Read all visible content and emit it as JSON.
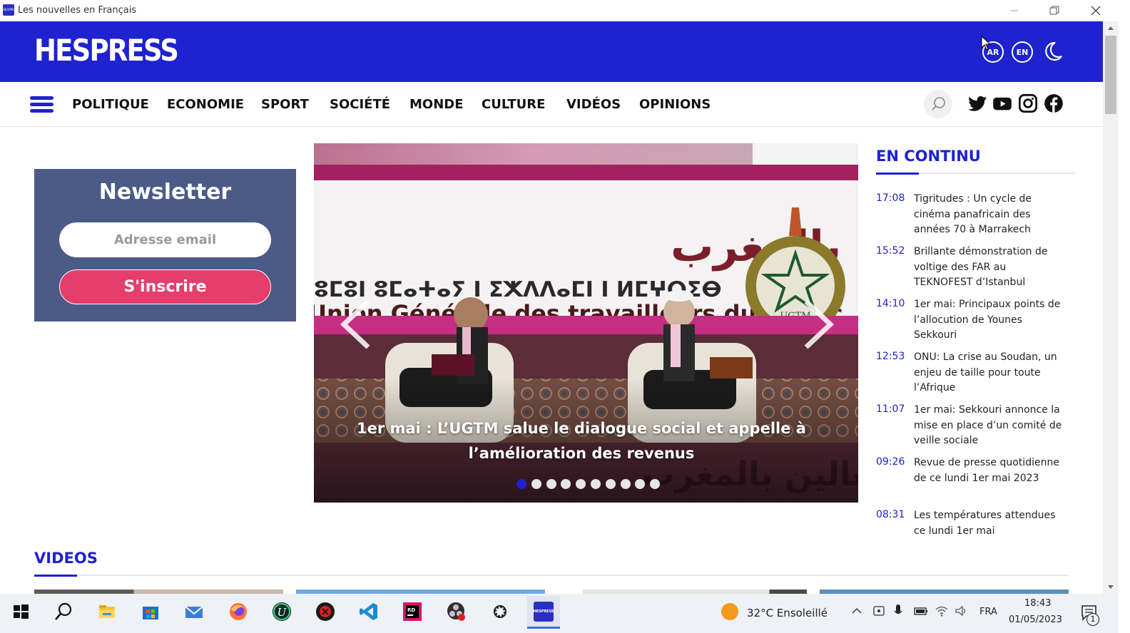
{
  "window": {
    "title": "Les nouvelles en Français",
    "app_icon_text": "HESPRESS"
  },
  "header": {
    "logo": "HESPRESS",
    "lang_ar": "AR",
    "lang_en": "EN",
    "bg_color": "#1e22cf"
  },
  "nav": {
    "items": [
      "POLITIQUE",
      "ECONOMIE",
      "SPORT",
      "SOCIÉTÉ",
      "MONDE",
      "CULTURE",
      "VIDÉOS",
      "OPINIONS"
    ],
    "socials": [
      "twitter-icon",
      "youtube-icon",
      "instagram-icon",
      "facebook-icon"
    ]
  },
  "newsletter": {
    "title": "Newsletter",
    "email_placeholder": "Adresse email",
    "submit_label": "S'inscrire",
    "bg_color": "#4b5a87",
    "button_color": "#e53d6c"
  },
  "hero": {
    "caption": "1er mai : L’UGTM salue le dialogue social et appelle à l’amélioration des revenus",
    "banner_arabic": "الاتحاد العام للشغالين بالمغرب",
    "banner_tifinagh": "ⵓⵎⵓⵏ ⵓⵎⴰⵜⴰⵢ ⵏ ⵉⵅⴷⴷⴰⵎⵏ ⵏ ⵍⵎⵖⵔⵉⴱ",
    "banner_french": "Union Générale des travailleurs du Maroc",
    "emblem_text": "UGTM",
    "slides_total": 10,
    "active_slide": 1
  },
  "en_continu": {
    "title": "EN CONTINU",
    "items": [
      {
        "time": "17:08",
        "text": "Tigritudes : Un cycle de cinéma panafricain des années 70 à Marrakech"
      },
      {
        "time": "15:52",
        "text": "Brillante démonstration de voltige des FAR au TEKNOFEST d’Istanbul"
      },
      {
        "time": "14:10",
        "text": "1er mai: Principaux points de l’allocution de Younes Sekkouri"
      },
      {
        "time": "12:53",
        "text": "ONU: La crise au Soudan, un enjeu de taille pour toute l’Afrique"
      },
      {
        "time": "11:07",
        "text": "1er mai: Sekkouri annonce la mise en place d’un comité de veille sociale"
      },
      {
        "time": "09:26",
        "text": "Revue de presse quotidienne de ce lundi 1er mai 2023"
      },
      {
        "time": "08:31",
        "text": "Les températures attendues ce lundi 1er mai"
      }
    ]
  },
  "videos": {
    "title": "VIDEOS"
  },
  "taskbar": {
    "weather": "32°C  Ensoleillé",
    "language": "FRA",
    "time": "18:43",
    "date": "01/05/2023",
    "notification_count": "1",
    "active_app_label": "HESPRESS"
  }
}
